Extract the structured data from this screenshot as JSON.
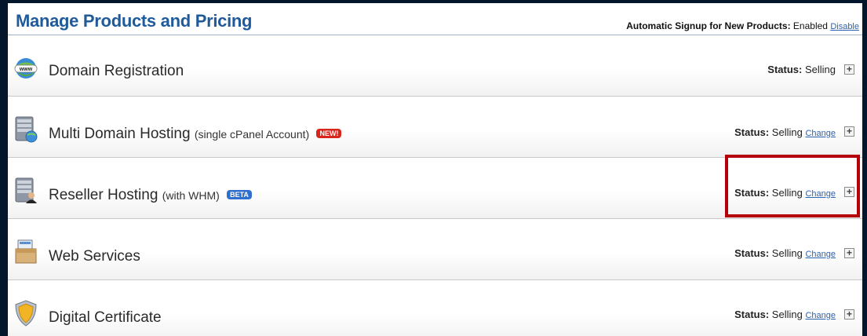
{
  "header": {
    "title": "Manage Products and Pricing",
    "auto_signup_label": "Automatic Signup for New Products:",
    "auto_signup_value": "Enabled",
    "auto_signup_action": "Disable"
  },
  "status_label": "Status:",
  "products": [
    {
      "name": "Domain Registration",
      "sub": "",
      "badge": "",
      "status": "Selling",
      "change": "",
      "icon": "globe-www-icon"
    },
    {
      "name": "Multi Domain Hosting",
      "sub": "(single cPanel Account)",
      "badge": "NEW!",
      "badge_color": "#d9261c",
      "status": "Selling",
      "change": "Change",
      "icon": "server-globe-icon"
    },
    {
      "name": "Reseller Hosting",
      "sub": "(with WHM)",
      "badge": "BETA",
      "badge_color": "#2f6fd0",
      "status": "Selling",
      "change": "Change",
      "icon": "server-user-icon"
    },
    {
      "name": "Web Services",
      "sub": "",
      "badge": "",
      "status": "Selling",
      "change": "Change",
      "icon": "web-box-icon"
    },
    {
      "name": "Digital Certificate",
      "sub": "",
      "badge": "",
      "status": "Selling",
      "change": "Change",
      "icon": "shield-icon"
    }
  ],
  "colors": {
    "title": "#1f5a9a",
    "link": "#2a63b4",
    "highlight": "#b3000b",
    "background": "#04162b"
  }
}
